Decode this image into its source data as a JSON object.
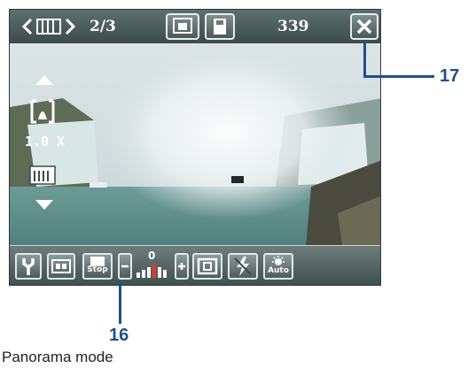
{
  "topbar": {
    "page_counter": "2/3",
    "shots_remaining": "339"
  },
  "zoom": {
    "level": "1.0 X"
  },
  "bottombar": {
    "stop_label": "Stop",
    "auto_label": "Auto",
    "exposure_value": "0"
  },
  "callouts": {
    "close_callout": "17",
    "stop_callout": "16"
  },
  "caption": "Panorama mode"
}
